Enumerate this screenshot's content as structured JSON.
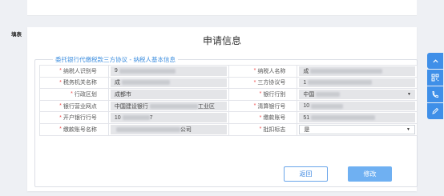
{
  "tag": "填表",
  "title": "申请信息",
  "section_title": "委托银行代缴税款三方协议 - 纳税人基本信息",
  "rows": [
    {
      "l1": "纳税人识别号",
      "v1": "9",
      "l2": "纳税人名称",
      "v2": "成"
    },
    {
      "l1": "税务机关名称",
      "v1": "成",
      "l2": "三方协议号",
      "v2": "1"
    },
    {
      "l1": "行政区划",
      "v1": "成都市",
      "l2": "银行行别",
      "v2": "中国"
    },
    {
      "l1": "银行营业网点",
      "v1": "中国建设银行",
      "v1b": "工业区",
      "l2": "清算银行号",
      "v2": "10"
    },
    {
      "l1": "开户银行行号",
      "v1": "10",
      "v1b": "7",
      "l2": "缴款账号",
      "v2": "51"
    },
    {
      "l1": "缴款账号名称",
      "v1": "",
      "v1b": "公司",
      "l2": "批扣标志",
      "v2": "是"
    }
  ],
  "buttons": {
    "back": "返回",
    "edit": "修改"
  },
  "colors": {
    "accent": "#3f8fe8",
    "required": "#f04b4b"
  }
}
